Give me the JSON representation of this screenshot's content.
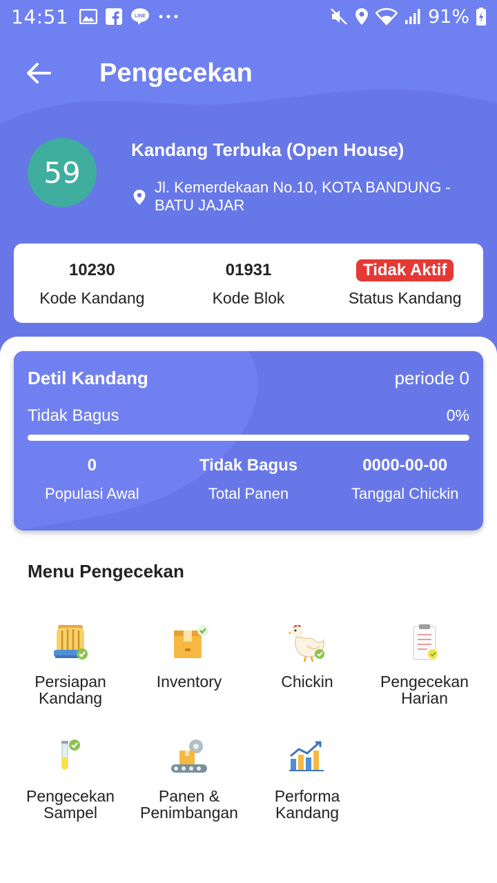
{
  "status_bar": {
    "time": "14:51",
    "battery": "91%",
    "left_icons": [
      "image-icon",
      "facebook-icon",
      "line-icon",
      "more-icon"
    ],
    "right_icons": [
      "mute-icon",
      "location-icon",
      "wifi-icon",
      "signal-icon",
      "battery-icon"
    ]
  },
  "appbar": {
    "title": "Pengecekan"
  },
  "farm": {
    "number": "59",
    "name": "Kandang Terbuka (Open House)",
    "address": "Jl. Kemerdekaan No.10, KOTA BANDUNG - BATU JAJAR"
  },
  "info": [
    {
      "value": "10230",
      "label": "Kode Kandang"
    },
    {
      "value": "01931",
      "label": "Kode Blok"
    },
    {
      "value": "Tidak Aktif",
      "label": "Status Kandang"
    }
  ],
  "detail": {
    "title": "Detil Kandang",
    "period": "periode 0",
    "quality": "Tidak Bagus",
    "percent": "0%",
    "progress_fraction": 0,
    "stats": [
      {
        "value": "0",
        "label": "Populasi Awal"
      },
      {
        "value": "Tidak Bagus",
        "label": "Total Panen"
      },
      {
        "value": "0000-00-00",
        "label": "Tanggal Chickin"
      }
    ]
  },
  "menu": {
    "title": "Menu Pengecekan",
    "items": [
      {
        "label": "Persiapan Kandang",
        "icon": "cage-icon"
      },
      {
        "label": "Inventory",
        "icon": "box-icon"
      },
      {
        "label": "Chickin",
        "icon": "chicken-icon"
      },
      {
        "label": "Pengecekan Harian",
        "icon": "clipboard-icon"
      },
      {
        "label": "Pengecekan Sampel",
        "icon": "test-tube-icon"
      },
      {
        "label": "Panen & Penimbangan",
        "icon": "conveyor-icon"
      },
      {
        "label": "Performa Kandang",
        "icon": "bar-chart-icon"
      }
    ]
  },
  "colors": {
    "header": "#6877e8",
    "avatar": "#3fae9e",
    "badge": "#e53935"
  }
}
